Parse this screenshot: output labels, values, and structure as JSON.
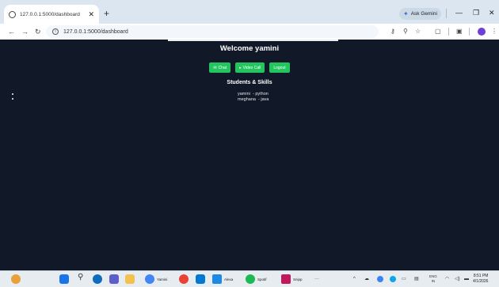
{
  "browser": {
    "tab_title": "127.0.0.1:5000/dashboard",
    "url": "127.0.0.1:5000/dashboard",
    "ask_label": "Ask Gemini"
  },
  "page": {
    "welcome": "Welcome yamini",
    "buttons": {
      "chat": "Chat",
      "video_call": "Video Call",
      "logout": "Logout"
    },
    "students_heading": "Students & Skills",
    "students": [
      {
        "name": "yamini",
        "skill": "python"
      },
      {
        "name": "meghana",
        "skill": "java"
      }
    ]
  },
  "taskbar": {
    "apps": [
      "Yamini",
      "Alexa",
      "Spotif",
      "Snipp"
    ],
    "lang_top": "ENG",
    "lang_bottom": "IN",
    "time": "8:51 PM",
    "date": "4/1/2026"
  },
  "colors": {
    "page_bg": "#111827",
    "button_green": "#22c55e"
  }
}
